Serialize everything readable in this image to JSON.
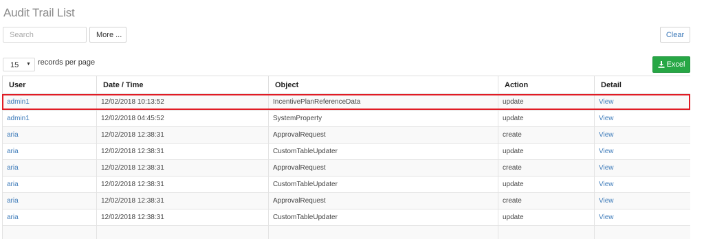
{
  "page": {
    "title": "Audit Trail List"
  },
  "toolbar": {
    "search_placeholder": "Search",
    "search_value": "",
    "more_label": "More ...",
    "clear_label": "Clear",
    "page_size": "15",
    "records_per_page_label": "records per page",
    "excel_label": "Excel",
    "excel_color": "#27a745"
  },
  "table": {
    "columns": [
      "User",
      "Date / Time",
      "Object",
      "Action",
      "Detail"
    ],
    "rows": [
      {
        "user": "admin1",
        "datetime": "12/02/2018 10:13:52",
        "object": "IncentivePlanReferenceData",
        "action": "update",
        "detail": "View",
        "highlighted": true
      },
      {
        "user": "admin1",
        "datetime": "12/02/2018 04:45:52",
        "object": "SystemProperty",
        "action": "update",
        "detail": "View"
      },
      {
        "user": "aria",
        "datetime": "12/02/2018 12:38:31",
        "object": "ApprovalRequest",
        "action": "create",
        "detail": "View"
      },
      {
        "user": "aria",
        "datetime": "12/02/2018 12:38:31",
        "object": "CustomTableUpdater",
        "action": "update",
        "detail": "View"
      },
      {
        "user": "aria",
        "datetime": "12/02/2018 12:38:31",
        "object": "ApprovalRequest",
        "action": "create",
        "detail": "View"
      },
      {
        "user": "aria",
        "datetime": "12/02/2018 12:38:31",
        "object": "CustomTableUpdater",
        "action": "update",
        "detail": "View"
      },
      {
        "user": "aria",
        "datetime": "12/02/2018 12:38:31",
        "object": "ApprovalRequest",
        "action": "create",
        "detail": "View"
      },
      {
        "user": "aria",
        "datetime": "12/02/2018 12:38:31",
        "object": "CustomTableUpdater",
        "action": "update",
        "detail": "View"
      }
    ]
  },
  "colors": {
    "link": "#3f7cba",
    "highlight": "#e01b24",
    "title": "#8a8a8a"
  }
}
